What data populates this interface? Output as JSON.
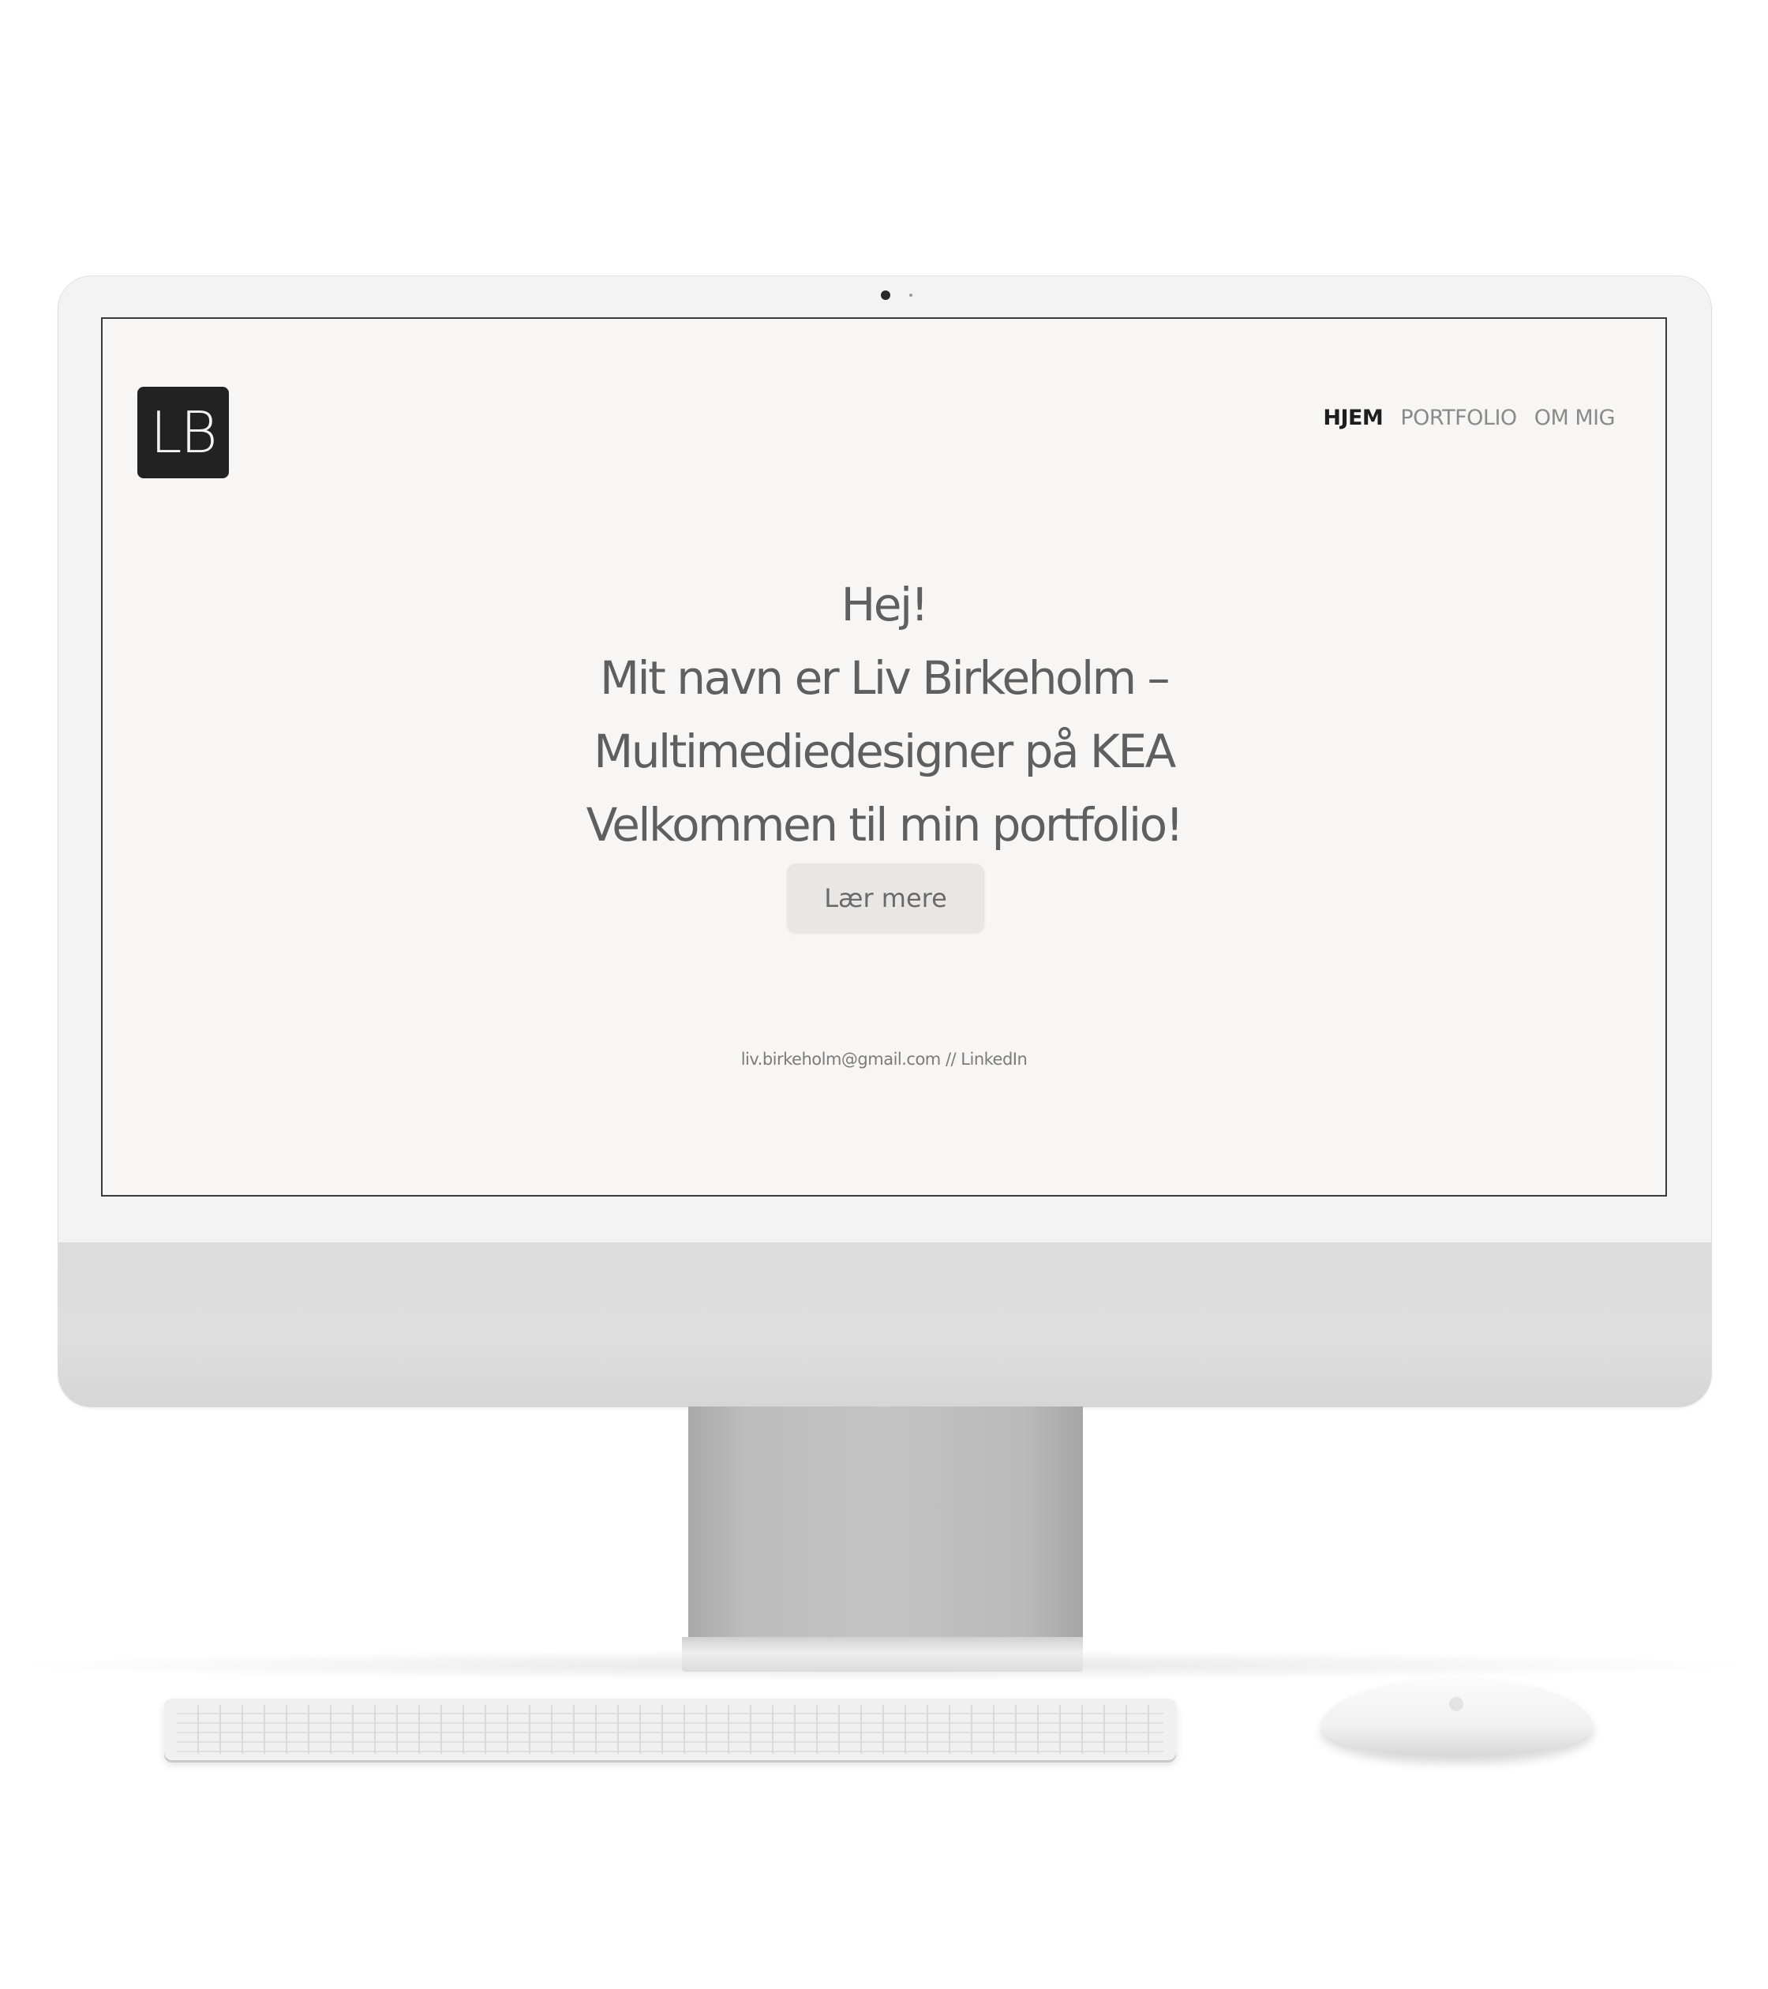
{
  "site": {
    "logo_text": "LB",
    "nav": [
      {
        "label": "HJEM",
        "active": true
      },
      {
        "label": "PORTFOLIO",
        "active": false
      },
      {
        "label": "OM MIG",
        "active": false
      }
    ],
    "hero": {
      "lines": [
        "Hej!",
        "Mit navn er Liv Birkeholm –",
        "Multimediedesigner på KEA",
        "Velkommen til min portfolio!"
      ],
      "cta_label": "Lær mere"
    },
    "footer": {
      "email": "liv.birkeholm@gmail.com",
      "separator": " // ",
      "link_label": "LinkedIn"
    }
  },
  "colors": {
    "screen_background": "#f7f6f4",
    "logo_background": "#222222",
    "nav_active": "#1e1e1e",
    "nav_inactive": "#8a8a8a",
    "hero_text": "#5f5f5f",
    "button_background": "#e8e7e5",
    "device_silver": "#dcdcdc"
  }
}
